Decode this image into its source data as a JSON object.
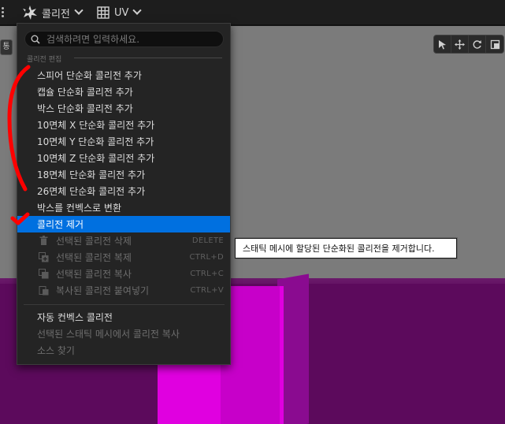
{
  "toolbar": {
    "collision_label": "콜리전",
    "uv_label": "UV"
  },
  "viewport": {
    "stub_label": "통"
  },
  "menu": {
    "search_placeholder": "검색하려면 입력하세요.",
    "section_title": "콜리전 편집",
    "items": [
      {
        "label": "스피어 단순화 콜리전 추가"
      },
      {
        "label": "캡슐 단순화 콜리전 추가"
      },
      {
        "label": "박스 단순화 콜리전 추가"
      },
      {
        "label": "10면체 X 단순화 콜리전 추가"
      },
      {
        "label": "10면체 Y 단순화 콜리전 추가"
      },
      {
        "label": "10면체 Z 단순화 콜리전 추가"
      },
      {
        "label": "18면체 단순화 콜리전 추가"
      },
      {
        "label": "26면체 단순화 콜리전 추가"
      },
      {
        "label": "박스를 컨벡스로 변환"
      },
      {
        "label": "콜리전 제거"
      }
    ],
    "sub_items": [
      {
        "label": "선택된 콜리전 삭제",
        "shortcut": "DELETE"
      },
      {
        "label": "선택된 콜리전 복제",
        "shortcut": "CTRL+D"
      },
      {
        "label": "선택된 콜리전 복사",
        "shortcut": "CTRL+C"
      },
      {
        "label": "복사된 콜리전 붙여넣기",
        "shortcut": "CTRL+V"
      }
    ],
    "bottom_items": [
      {
        "label": "자동 컨벡스 콜리전"
      },
      {
        "label": "선택된 스태틱 메시에서 콜리전 복사"
      },
      {
        "label": "소스 찾기"
      }
    ]
  },
  "tooltip": {
    "text": "스태틱 메시에 할당된 단순화된 콜리전을 제거합니다."
  },
  "colors": {
    "selection": "#0070e0",
    "annotation": "#ff0000",
    "cube_magenta": "#e000e0"
  }
}
